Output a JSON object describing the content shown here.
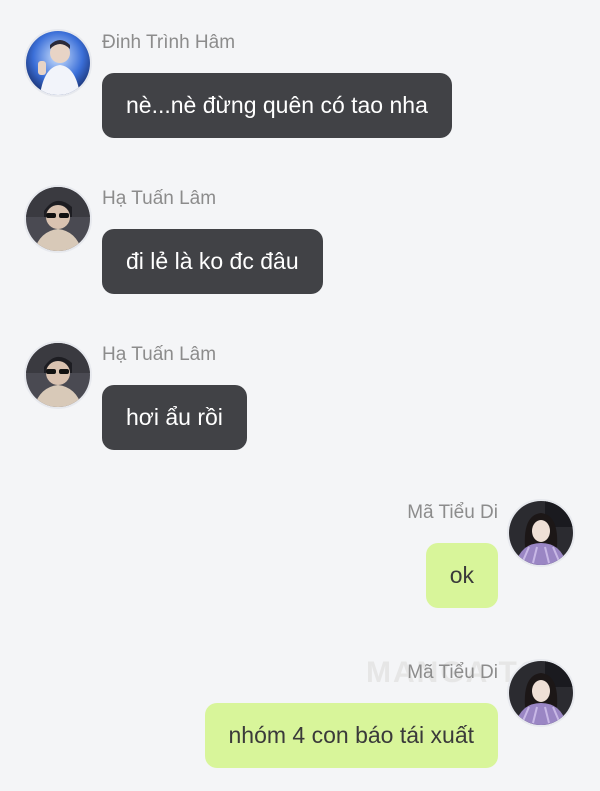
{
  "messages": [
    {
      "side": "left",
      "sender": "Đinh Trình Hâm",
      "text": "nè...nè đừng quên có tao nha",
      "avatar_icon": "avatar-blue-stage-photo"
    },
    {
      "side": "left",
      "sender": "Hạ Tuấn Lâm",
      "text": "đi lẻ là ko đc đâu",
      "avatar_icon": "avatar-sunglasses-photo"
    },
    {
      "side": "left",
      "sender": "Hạ Tuấn Lâm",
      "text": "hơi ẩu rồi",
      "avatar_icon": "avatar-sunglasses-photo"
    },
    {
      "side": "right",
      "sender": "Mã Tiểu Di",
      "text": "ok",
      "avatar_icon": "avatar-girl-purple-photo"
    },
    {
      "side": "right",
      "sender": "Mã Tiểu Di",
      "text": "nhóm 4 con báo tái xuất",
      "avatar_icon": "avatar-girl-purple-photo"
    }
  ],
  "watermark": "MANGA TO",
  "colors": {
    "background": "#f4f5f7",
    "left_bubble": "#414246",
    "right_bubble": "#d8f59a",
    "sender_name": "#8c8c8c"
  }
}
